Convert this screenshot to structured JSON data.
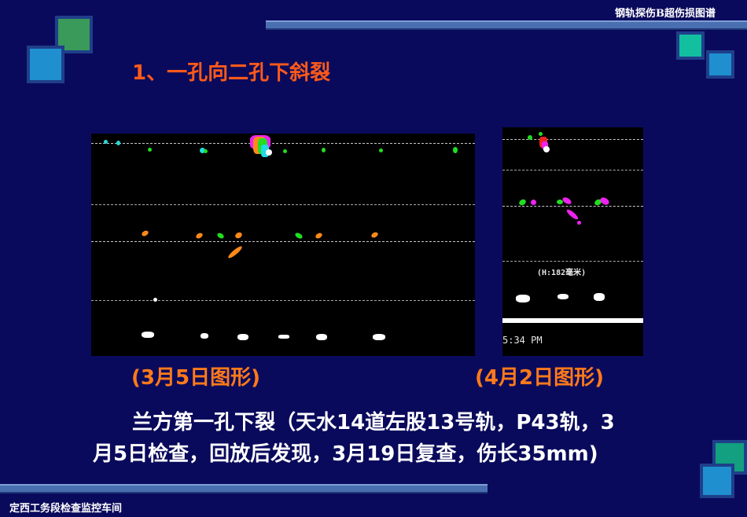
{
  "header": {
    "title": "钢轨探伤B超伤损图谱"
  },
  "slide": {
    "title": "1、一孔向二孔下斜裂",
    "caption_left": "(3月5日图形)",
    "caption_right": "(4月2日图形)",
    "body_line1": "兰方第一孔下裂（天水14道左股13号轨，P43轨，3",
    "body_line2": "月5日检查，回放后发现，3月19日复查，伤长35mm)"
  },
  "image2": {
    "label": "(H:182毫米)",
    "time": "5:34 PM"
  },
  "footer": {
    "text": "定西工务段检查监控车间"
  },
  "colors": {
    "background": "#0a0a5c",
    "title": "#ff5a1a",
    "caption": "#ff7a1a",
    "accent_bar": "#4a6fb0",
    "mark_green": "#22dd22",
    "mark_orange": "#ff8a1a",
    "mark_magenta": "#ee22ee",
    "mark_cyan": "#22dddd",
    "mark_white": "#ffffff"
  }
}
